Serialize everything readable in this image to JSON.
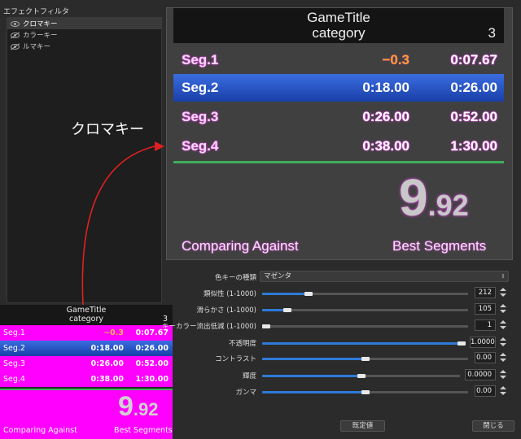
{
  "filters": {
    "title": "エフェクトフィルタ",
    "items": [
      {
        "label": "クロマキー",
        "visible": true,
        "selected": true
      },
      {
        "label": "カラーキー",
        "visible": false,
        "selected": false
      },
      {
        "label": "ルマキー",
        "visible": false,
        "selected": false
      }
    ]
  },
  "annotation": "クロマキー",
  "livesplit": {
    "game": "GameTitle",
    "category": "category",
    "attempts": "3",
    "segments": [
      {
        "name": "Seg.1",
        "delta": "−0.3",
        "time": "0:07.67",
        "gold": true
      },
      {
        "name": "Seg.2",
        "delta": "0:18.00",
        "time": "0:26.00",
        "current": true
      },
      {
        "name": "Seg.3",
        "delta": "0:26.00",
        "time": "0:52.00"
      },
      {
        "name": "Seg.4",
        "delta": "0:38.00",
        "time": "1:30.00"
      }
    ],
    "timer_main": "9",
    "timer_frac": ".92",
    "comparing_label": "Comparing Against",
    "comparison": "Best Segments"
  },
  "properties": {
    "key_type_label": "色キーの種類",
    "key_type_value": "マゼンタ",
    "sliders": [
      {
        "label": "類似性 (1-1000)",
        "value": "212",
        "level": 0.212
      },
      {
        "label": "滑らかさ (1-1000)",
        "value": "105",
        "level": 0.105
      },
      {
        "label": "キーカラー流出低減 (1-1000)",
        "value": "1",
        "level": 0.001
      },
      {
        "label": "不透明度",
        "value": "1.0000",
        "level": 1.0
      },
      {
        "label": "コントラスト",
        "value": "0.00",
        "level": 0.5
      },
      {
        "label": "輝度",
        "value": "0.0000",
        "level": 0.5
      },
      {
        "label": "ガンマ",
        "value": "0.00",
        "level": 0.5
      }
    ],
    "defaults_button": "既定値",
    "close_button": "閉じる"
  }
}
